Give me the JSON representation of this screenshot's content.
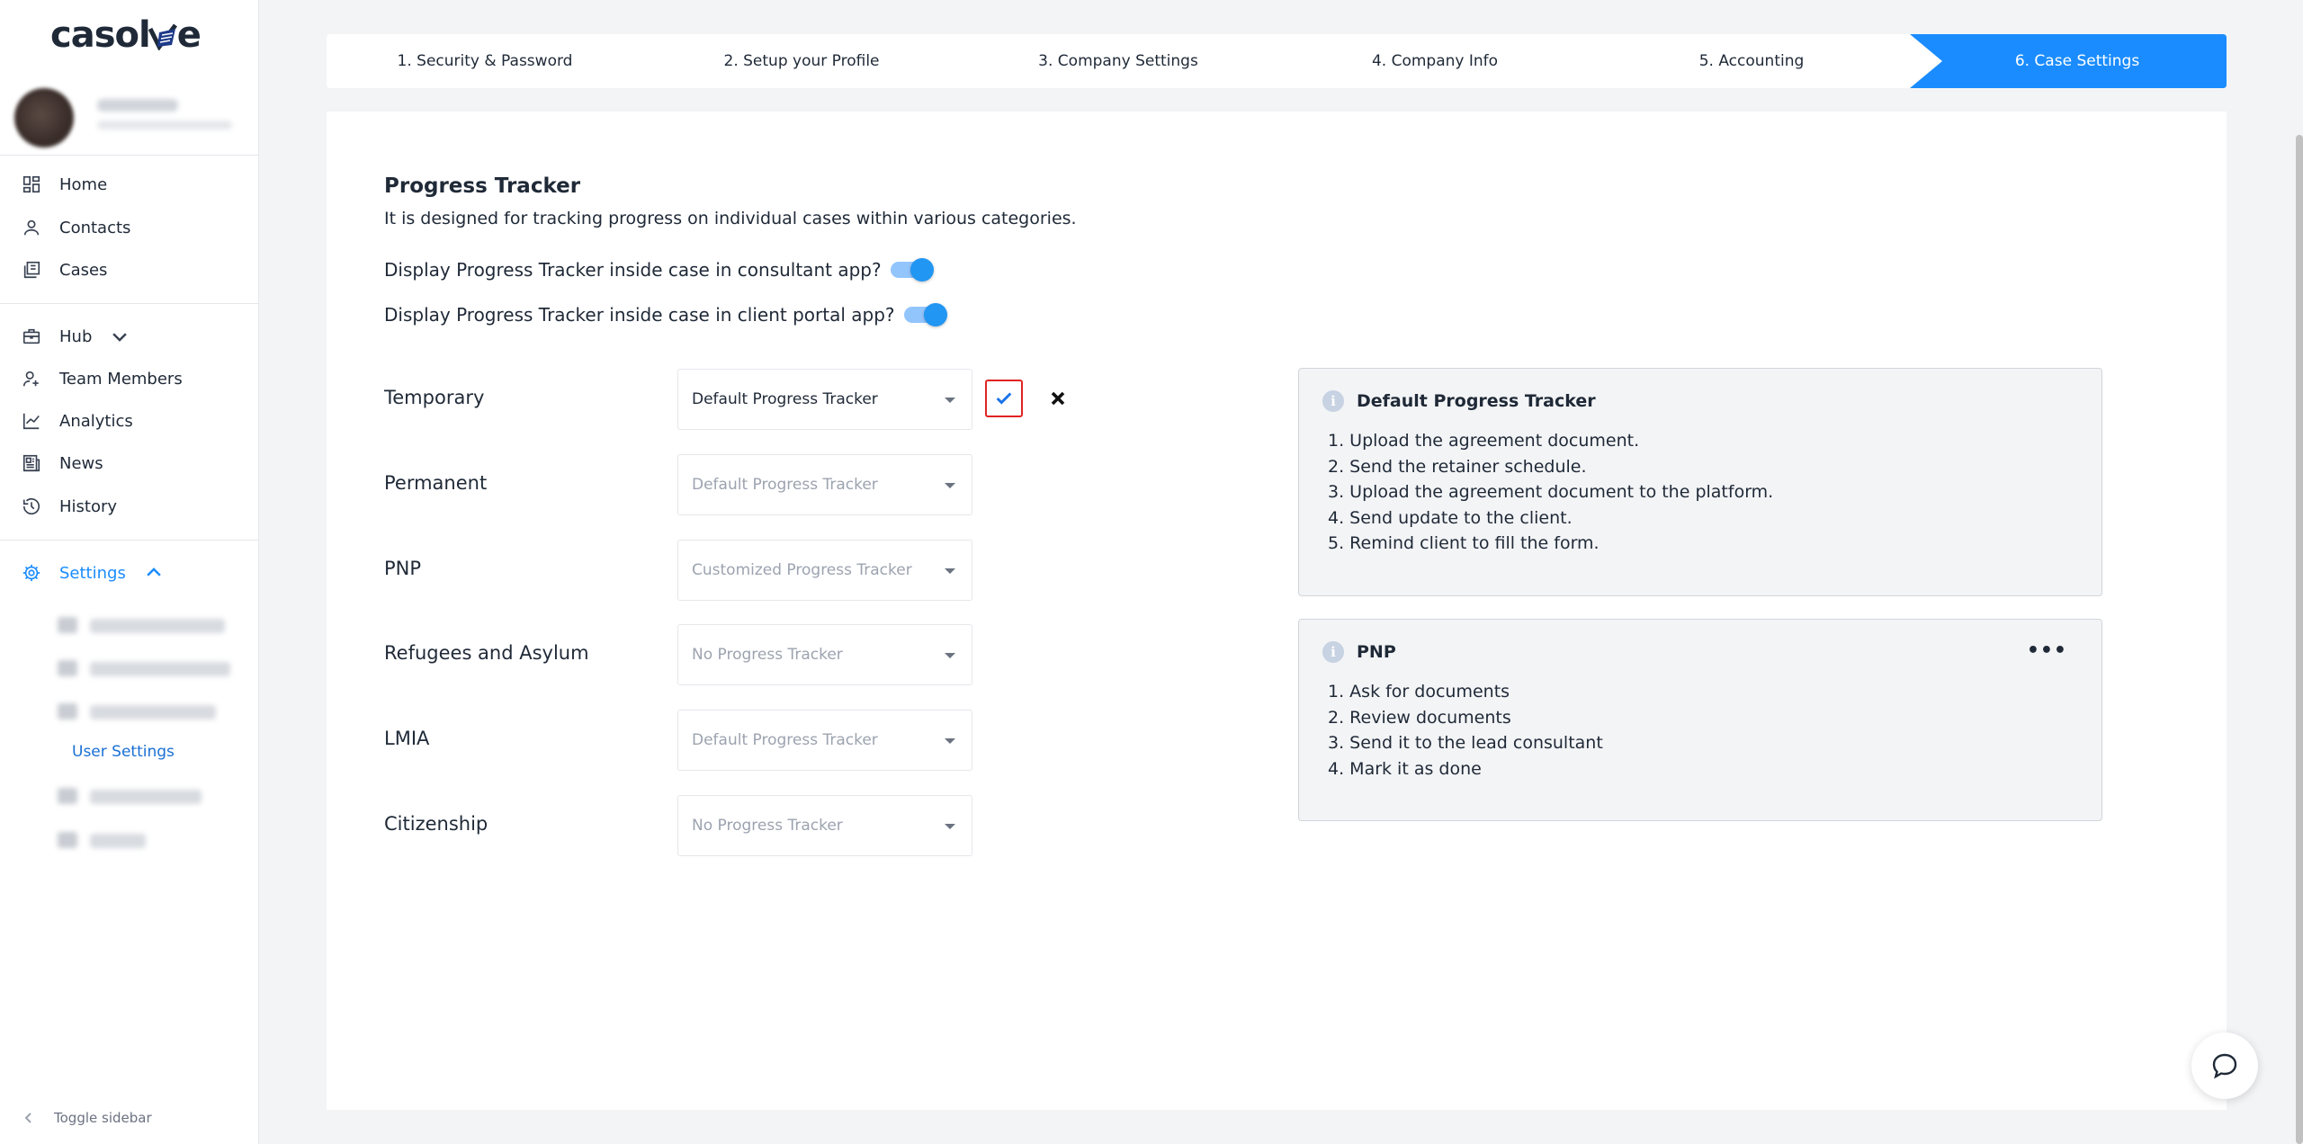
{
  "brand": {
    "logo_text": "casolve"
  },
  "sidebar": {
    "nav": [
      {
        "label": "Home",
        "icon": "dashboard-icon"
      },
      {
        "label": "Contacts",
        "icon": "user-icon"
      },
      {
        "label": "Cases",
        "icon": "cases-icon"
      }
    ],
    "hub": {
      "label": "Hub",
      "icon": "briefcase-icon"
    },
    "hub_items": [
      {
        "label": "Team Members",
        "icon": "team-icon"
      },
      {
        "label": "Analytics",
        "icon": "chart-line-icon"
      },
      {
        "label": "News",
        "icon": "news-icon"
      },
      {
        "label": "History",
        "icon": "history-icon"
      }
    ],
    "settings": {
      "label": "Settings",
      "icon": "gear-icon"
    },
    "settings_active_item": "User Settings",
    "toggle_label": "Toggle sidebar"
  },
  "stepper": {
    "steps": [
      "1. Security & Password",
      "2. Setup your Profile",
      "3. Company Settings",
      "4. Company Info",
      "5. Accounting",
      "6. Case Settings"
    ],
    "active_index": 5,
    "active_color": "#1a8cff"
  },
  "progress_tracker": {
    "title": "Progress Tracker",
    "description": "It is designed for tracking progress on individual cases within various categories.",
    "toggles": [
      {
        "label": "Display Progress Tracker inside case in consultant app?",
        "on": true
      },
      {
        "label": "Display Progress Tracker inside case in client portal app?",
        "on": true
      }
    ],
    "cases": [
      {
        "label": "Temporary",
        "value": "Default Progress Tracker",
        "editing": true
      },
      {
        "label": "Permanent",
        "value": "Default Progress Tracker",
        "editing": false
      },
      {
        "label": "PNP",
        "value": "Customized Progress Tracker",
        "editing": false
      },
      {
        "label": "Refugees and Asylum",
        "value": "No Progress Tracker",
        "editing": false
      },
      {
        "label": "LMIA",
        "value": "Default Progress Tracker",
        "editing": false
      },
      {
        "label": "Citizenship",
        "value": "No Progress Tracker",
        "editing": false
      }
    ]
  },
  "info_cards": [
    {
      "title": "Default Progress Tracker",
      "steps": [
        "Upload the agreement document.",
        "Send the retainer schedule.",
        "Upload the agreement document to the platform.",
        "Send update to the client.",
        "Remind client to fill the form."
      ]
    },
    {
      "title": "PNP",
      "steps": [
        "Ask for documents",
        "Review documents",
        "Send it to the lead consultant",
        "Mark it as done"
      ]
    }
  ],
  "info_icon_glyph": "i",
  "more_glyph": "•••"
}
